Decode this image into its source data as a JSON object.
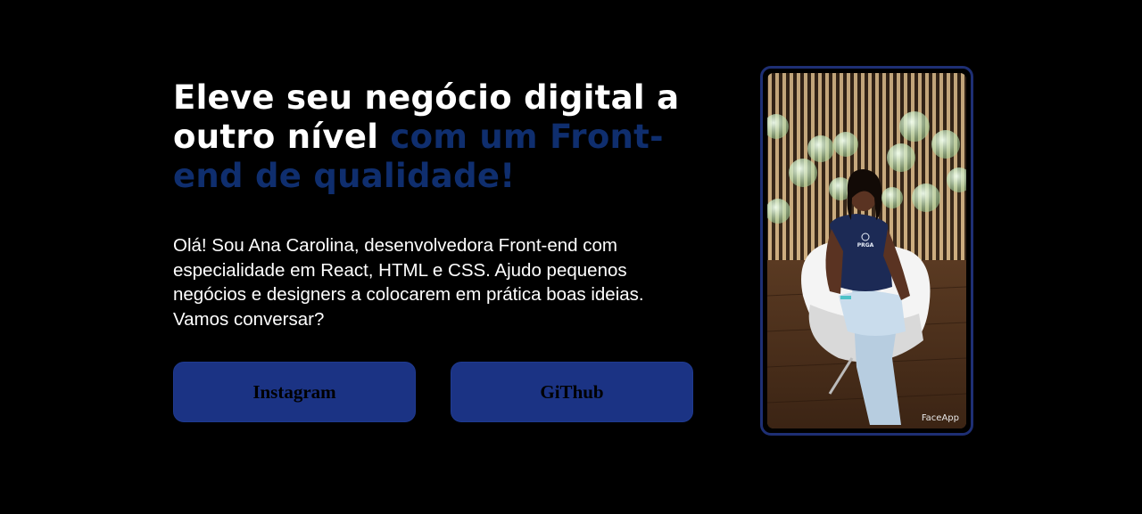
{
  "hero": {
    "headline_white": "Eleve seu negócio digital a outro nível",
    "headline_accent": "com um Front-end de qualidade!",
    "intro": "Olá! Sou Ana Carolina, desenvolvedora Front-end com especialidade em React, HTML e CSS. Ajudo pequenos negócios e designers a colocarem em prática boas ideias. Vamos conversar?",
    "buttons": {
      "instagram": "Instagram",
      "github": "GiThub"
    }
  },
  "photo": {
    "watermark": "FaceApp",
    "shirt_text": "PRGA"
  },
  "colors": {
    "background": "#000000",
    "accent_text": "#0f2e6e",
    "button_bg": "#1b3384",
    "frame_border": "#1e2f74"
  }
}
